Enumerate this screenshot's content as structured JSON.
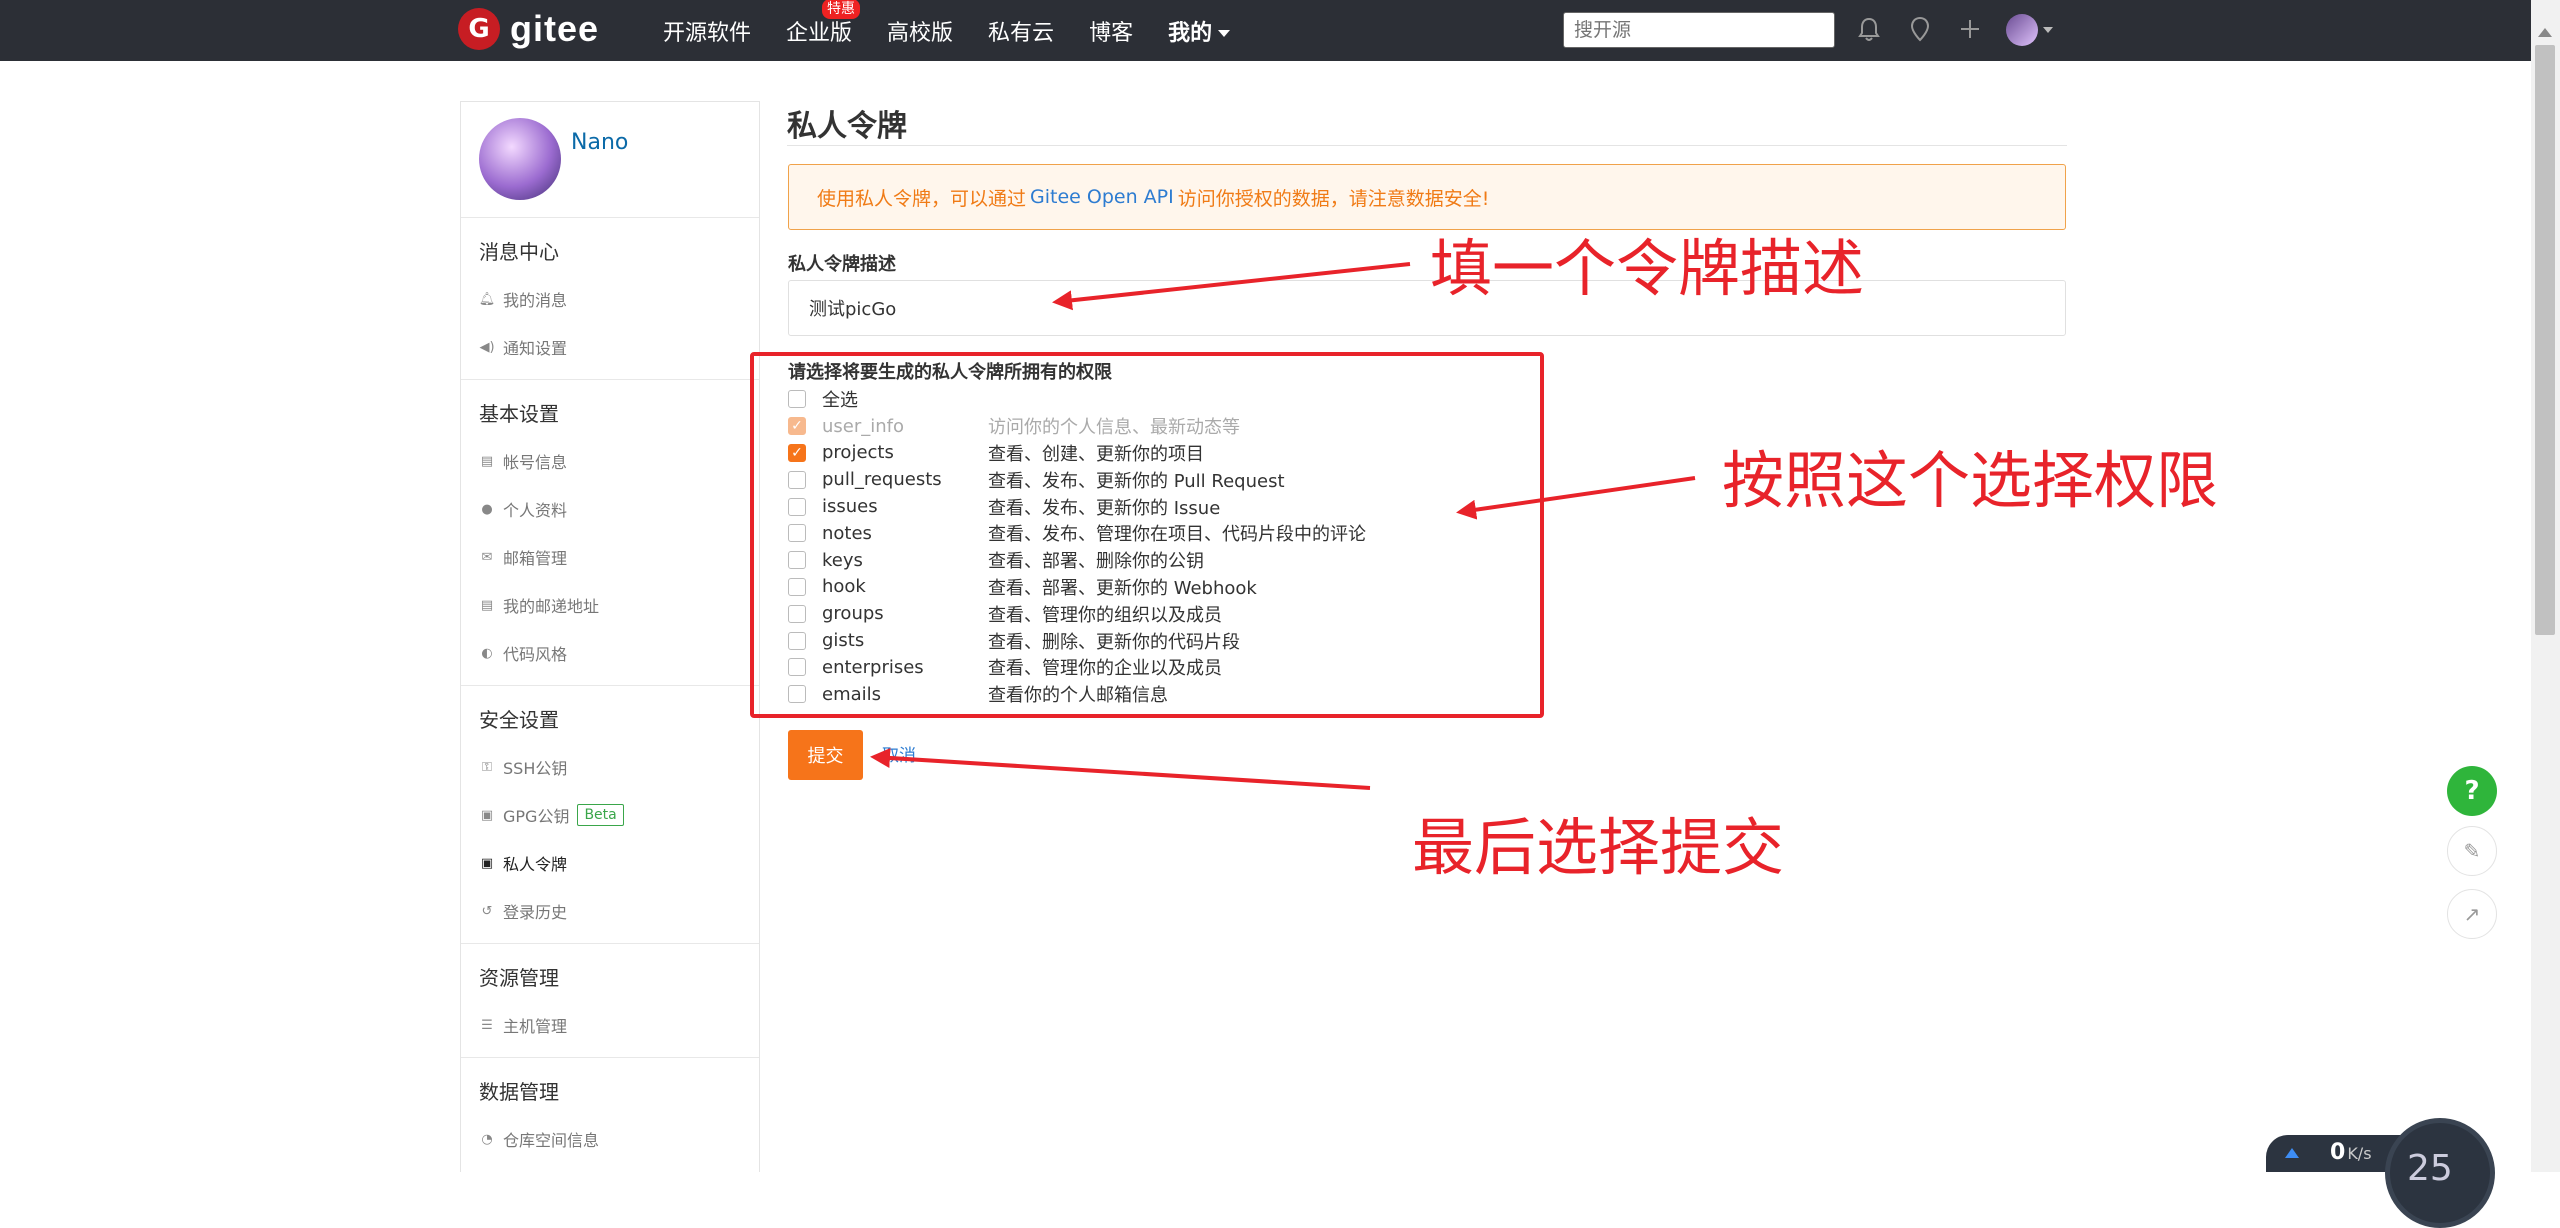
{
  "topnav": {
    "logo_text": "gitee",
    "logo_letter": "G",
    "items": [
      {
        "label": "开源软件"
      },
      {
        "label": "企业版",
        "badge": "特惠"
      },
      {
        "label": "高校版"
      },
      {
        "label": "私有云"
      },
      {
        "label": "博客"
      },
      {
        "label": "我的"
      }
    ],
    "search_placeholder": "搜开源"
  },
  "sidebar": {
    "username": "Nano",
    "sections": [
      {
        "title": "消息中心",
        "items": [
          {
            "label": "我的消息",
            "icon": "bell-icon"
          },
          {
            "label": "通知设置",
            "icon": "volume-icon"
          }
        ]
      },
      {
        "title": "基本设置",
        "items": [
          {
            "label": "帐号信息",
            "icon": "id-card-icon"
          },
          {
            "label": "个人资料",
            "icon": "user-icon"
          },
          {
            "label": "邮箱管理",
            "icon": "envelope-icon"
          },
          {
            "label": "我的邮递地址",
            "icon": "address-card-icon"
          },
          {
            "label": "代码风格",
            "icon": "palette-icon"
          }
        ]
      },
      {
        "title": "安全设置",
        "items": [
          {
            "label": "SSH公钥",
            "icon": "key-icon"
          },
          {
            "label": "GPG公钥",
            "icon": "lock-icon",
            "badge": "Beta"
          },
          {
            "label": "私人令牌",
            "icon": "token-icon",
            "active": true
          },
          {
            "label": "登录历史",
            "icon": "history-icon"
          }
        ]
      },
      {
        "title": "资源管理",
        "items": [
          {
            "label": "主机管理",
            "icon": "server-icon"
          }
        ]
      },
      {
        "title": "数据管理",
        "items": [
          {
            "label": "仓库空间信息",
            "icon": "pie-chart-icon"
          }
        ]
      }
    ]
  },
  "main": {
    "title": "私人令牌",
    "notice": {
      "before": "使用私人令牌，可以通过",
      "link": "Gitee Open API",
      "after": "访问你授权的数据，请注意数据安全!"
    },
    "desc_label": "私人令牌描述",
    "desc_value": "测试picGo",
    "perm_title": "请选择将要生成的私人令牌所拥有的权限",
    "select_all": "全选",
    "permissions": [
      {
        "name": "user_info",
        "desc": "访问你的个人信息、最新动态等",
        "checked": true,
        "disabled": true
      },
      {
        "name": "projects",
        "desc": "查看、创建、更新你的项目",
        "checked": true,
        "disabled": false
      },
      {
        "name": "pull_requests",
        "desc": "查看、发布、更新你的 Pull Request",
        "checked": false,
        "disabled": false
      },
      {
        "name": "issues",
        "desc": "查看、发布、更新你的 Issue",
        "checked": false,
        "disabled": false
      },
      {
        "name": "notes",
        "desc": "查看、发布、管理你在项目、代码片段中的评论",
        "checked": false,
        "disabled": false
      },
      {
        "name": "keys",
        "desc": "查看、部署、删除你的公钥",
        "checked": false,
        "disabled": false
      },
      {
        "name": "hook",
        "desc": "查看、部署、更新你的 Webhook",
        "checked": false,
        "disabled": false
      },
      {
        "name": "groups",
        "desc": "查看、管理你的组织以及成员",
        "checked": false,
        "disabled": false
      },
      {
        "name": "gists",
        "desc": "查看、删除、更新你的代码片段",
        "checked": false,
        "disabled": false
      },
      {
        "name": "enterprises",
        "desc": "查看、管理你的企业以及成员",
        "checked": false,
        "disabled": false
      },
      {
        "name": "emails",
        "desc": "查看你的个人邮箱信息",
        "checked": false,
        "disabled": false
      }
    ],
    "submit_label": "提交",
    "cancel_label": "取消"
  },
  "annotations": {
    "fill_desc": "填一个令牌描述",
    "select_perms": "按照这个选择权限",
    "submit_last": "最后选择提交",
    "color": "#e8232a"
  },
  "floating": {
    "help": "?"
  },
  "speed_widget": {
    "value": "0",
    "unit": "K/s",
    "gauge": "25"
  },
  "colors": {
    "accent": "#f6741a",
    "nav_bg": "#2c2f36",
    "help_green": "#2fb53b",
    "link": "#2d7cd1"
  }
}
